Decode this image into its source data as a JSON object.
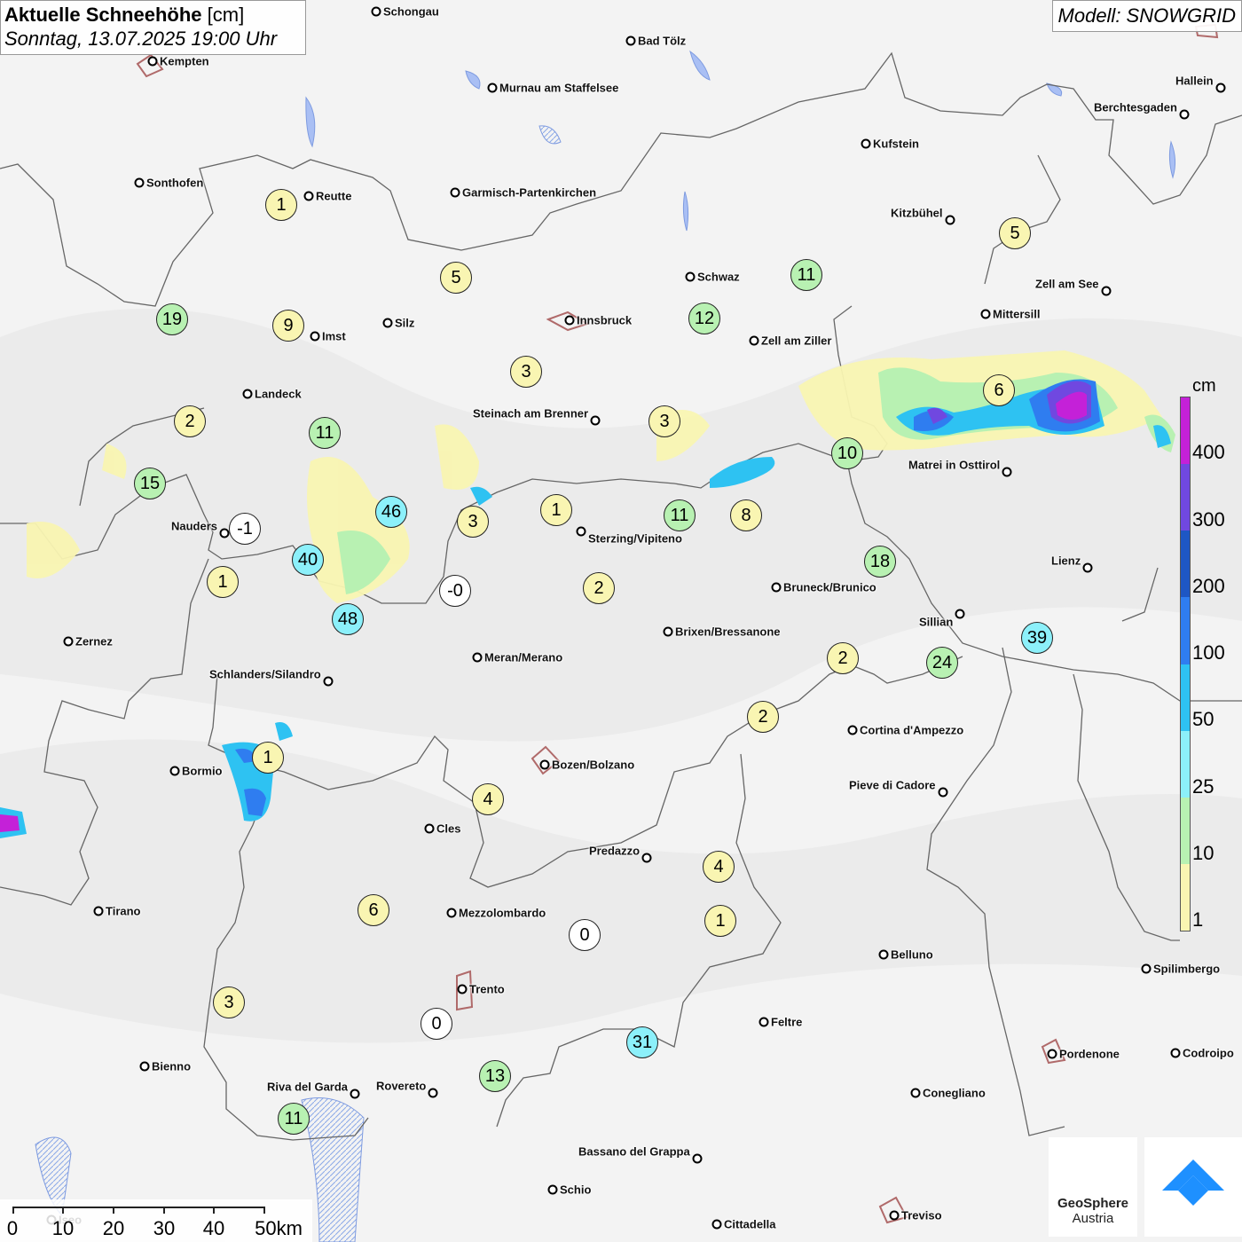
{
  "title": {
    "main": "Aktuelle Schneehöhe",
    "unit": "[cm]",
    "datetime": "Sonntag, 13.07.2025 19:00 Uhr"
  },
  "model": "Modell: SNOWGRID",
  "colors": {
    "c1": "#f9f5b2",
    "c10": "#b8f1b2",
    "c25": "#8cf0fa",
    "c50": "#2ec2f2",
    "c100": "#2f7df0",
    "c200": "#1e57c4",
    "c300": "#7048e0",
    "c400": "#c421d8",
    "neg": "#ffffff"
  },
  "legend": {
    "unit": "cm",
    "labels": [
      "400",
      "300",
      "200",
      "100",
      "50",
      "25",
      "10",
      "1"
    ]
  },
  "scale": {
    "labels": [
      "0",
      "10",
      "20",
      "30",
      "40",
      "50km"
    ]
  },
  "logo": {
    "name": "GeoSphere",
    "sub": "Austria"
  },
  "towns": [
    {
      "name": "Schongau"
    },
    {
      "name": "Bad Tölz"
    },
    {
      "name": "Kempten"
    },
    {
      "name": "Murnau am Staffelsee"
    },
    {
      "name": "Hallein"
    },
    {
      "name": "Berchtesgaden"
    },
    {
      "name": "Kufstein"
    },
    {
      "name": "Sonthofen"
    },
    {
      "name": "Reutte"
    },
    {
      "name": "Garmisch-Partenkirchen"
    },
    {
      "name": "Kitzbühel"
    },
    {
      "name": "Schwaz"
    },
    {
      "name": "Zell am See"
    },
    {
      "name": "Innsbruck"
    },
    {
      "name": "Mittersill"
    },
    {
      "name": "Silz"
    },
    {
      "name": "Imst"
    },
    {
      "name": "Zell am Ziller"
    },
    {
      "name": "Landeck"
    },
    {
      "name": "Steinach am Brenner"
    },
    {
      "name": "Matrei in Osttirol"
    },
    {
      "name": "Nauders"
    },
    {
      "name": "Sterzing/Vipiteno"
    },
    {
      "name": "Lienz"
    },
    {
      "name": "Bruneck/Brunico"
    },
    {
      "name": "Sillian"
    },
    {
      "name": "Zernez"
    },
    {
      "name": "Brixen/Bressanone"
    },
    {
      "name": "Meran/Merano"
    },
    {
      "name": "Schlanders/Silandro"
    },
    {
      "name": "Cortina d'Ampezzo"
    },
    {
      "name": "Bozen/Bolzano"
    },
    {
      "name": "Bormio"
    },
    {
      "name": "Pieve di Cadore"
    },
    {
      "name": "Cles"
    },
    {
      "name": "Predazzo"
    },
    {
      "name": "Tirano"
    },
    {
      "name": "Mezzolombardo"
    },
    {
      "name": "Belluno"
    },
    {
      "name": "Spilimbergo"
    },
    {
      "name": "Trento"
    },
    {
      "name": "Feltre"
    },
    {
      "name": "Pordenone"
    },
    {
      "name": "Codroipo"
    },
    {
      "name": "Bienno"
    },
    {
      "name": "Riva del Garda"
    },
    {
      "name": "Rovereto"
    },
    {
      "name": "Conegliano"
    },
    {
      "name": "Bassano del Grappa"
    },
    {
      "name": "Schio"
    },
    {
      "name": "Treviso"
    },
    {
      "name": "Cittadella"
    },
    {
      "name": "Iseo"
    }
  ],
  "stations": [
    {
      "value": "1"
    },
    {
      "value": "5"
    },
    {
      "value": "5"
    },
    {
      "value": "11"
    },
    {
      "value": "19"
    },
    {
      "value": "9"
    },
    {
      "value": "12"
    },
    {
      "value": "3"
    },
    {
      "value": "6"
    },
    {
      "value": "2"
    },
    {
      "value": "11"
    },
    {
      "value": "3"
    },
    {
      "value": "10"
    },
    {
      "value": "15"
    },
    {
      "value": "46"
    },
    {
      "value": "-1"
    },
    {
      "value": "3"
    },
    {
      "value": "1"
    },
    {
      "value": "11"
    },
    {
      "value": "8"
    },
    {
      "value": "40"
    },
    {
      "value": "18"
    },
    {
      "value": "1"
    },
    {
      "value": "-0"
    },
    {
      "value": "2"
    },
    {
      "value": "48"
    },
    {
      "value": "39"
    },
    {
      "value": "2"
    },
    {
      "value": "24"
    },
    {
      "value": "2"
    },
    {
      "value": "1"
    },
    {
      "value": "4"
    },
    {
      "value": "4"
    },
    {
      "value": "6"
    },
    {
      "value": "0"
    },
    {
      "value": "1"
    },
    {
      "value": "3"
    },
    {
      "value": "0"
    },
    {
      "value": "31"
    },
    {
      "value": "13"
    },
    {
      "value": "11"
    }
  ]
}
